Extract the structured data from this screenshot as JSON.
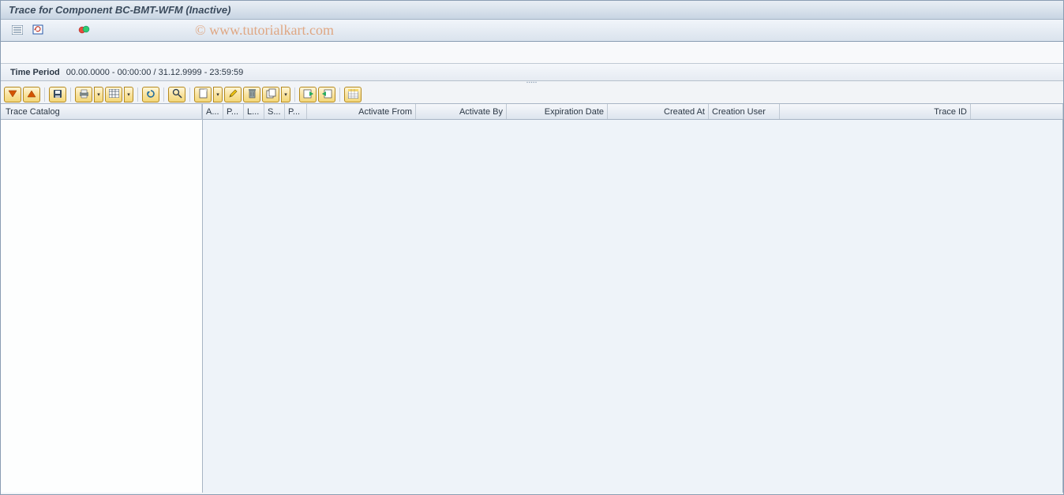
{
  "title": "Trace for Component BC-BMT-WFM (Inactive)",
  "watermark": "© www.tutorialkart.com",
  "top_toolbar": {
    "btn_list": "list",
    "btn_refresh": "refresh",
    "btn_activate": "activate"
  },
  "timebar": {
    "label": "Time Period",
    "value": "00.00.0000 - 00:00:00 / 31.12.9999 - 23:59:59"
  },
  "alv_icons": {
    "expand": "expand",
    "collapse": "collapse",
    "save_layout": "save-layout",
    "print": "print",
    "export": "export",
    "grid": "grid",
    "refresh": "refresh",
    "find": "find",
    "create": "create",
    "change": "change",
    "delete": "delete",
    "copy": "copy",
    "import": "import",
    "export2": "export",
    "spreadsheet": "spreadsheet"
  },
  "columns": {
    "trace_catalog": "Trace Catalog",
    "a": "A...",
    "p": "P...",
    "l": "L...",
    "s": "S...",
    "p2": "P...",
    "activate_from": "Activate From",
    "activate_by": "Activate By",
    "expiration_date": "Expiration Date",
    "created_at": "Created At",
    "creation_user": "Creation User",
    "trace_id": "Trace ID"
  }
}
